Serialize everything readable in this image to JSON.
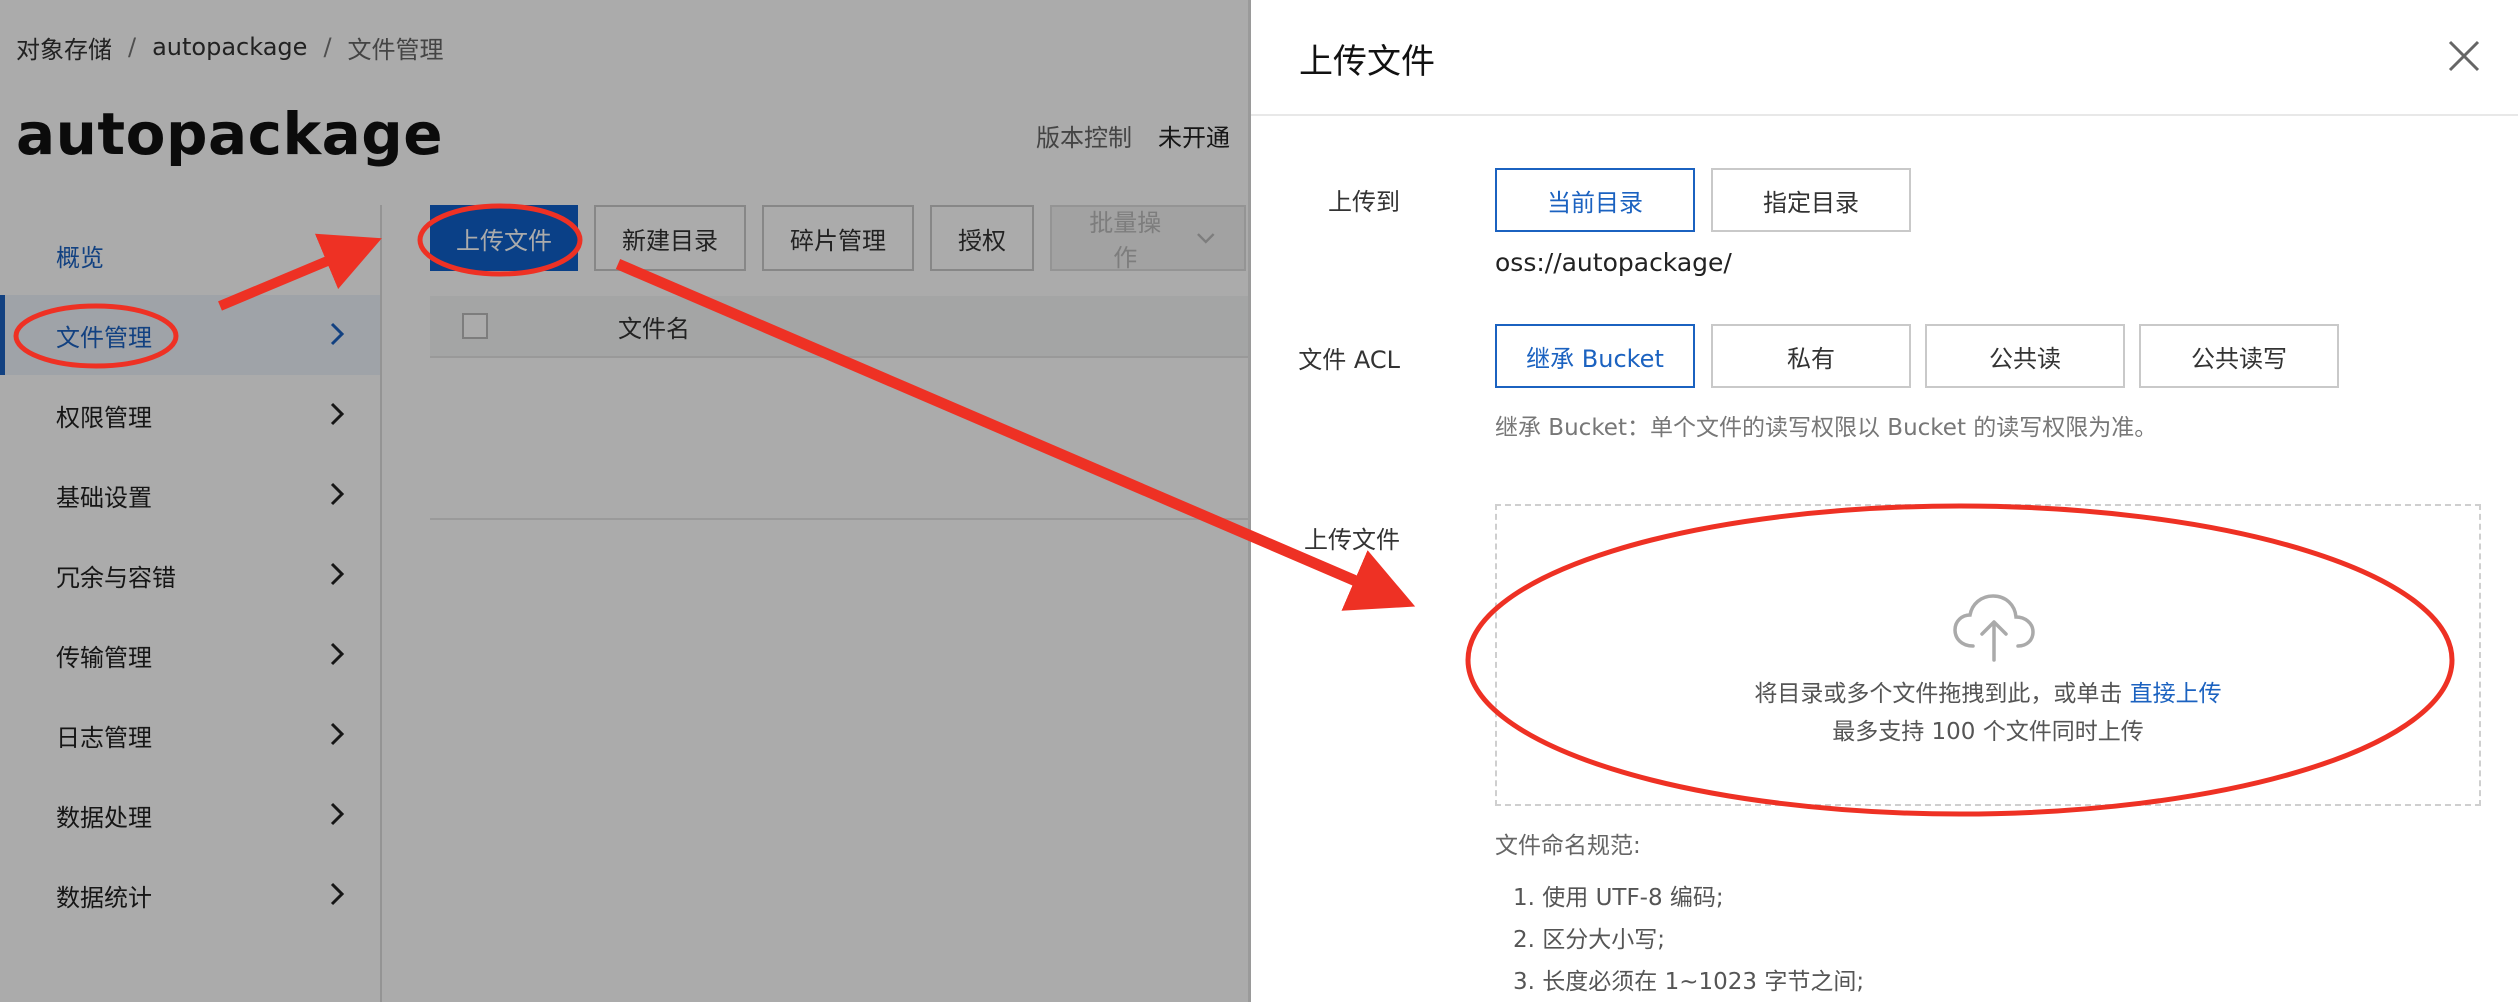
{
  "breadcrumb": {
    "item1": "对象存储",
    "item2": "autopackage",
    "item3": "文件管理",
    "sep": "/"
  },
  "page": {
    "title": "autopackage",
    "version_control": "版本控制",
    "status": "未开通"
  },
  "sidebar": {
    "items": [
      {
        "label": "概览"
      },
      {
        "label": "文件管理"
      },
      {
        "label": "权限管理"
      },
      {
        "label": "基础设置"
      },
      {
        "label": "冗余与容错"
      },
      {
        "label": "传输管理"
      },
      {
        "label": "日志管理"
      },
      {
        "label": "数据处理"
      },
      {
        "label": "数据统计"
      }
    ]
  },
  "toolbar": {
    "upload": "上传文件",
    "new_dir": "新建目录",
    "fragment": "碎片管理",
    "auth": "授权",
    "batch": "批量操作"
  },
  "table": {
    "col_name": "文件名"
  },
  "drawer": {
    "title": "上传文件",
    "upload_to_label": "上传到",
    "current_dir": "当前目录",
    "specify_dir": "指定目录",
    "path": "oss://autopackage/",
    "acl_label": "文件 ACL",
    "acl_inherit": "继承 Bucket",
    "acl_private": "私有",
    "acl_public_read": "公共读",
    "acl_public_rw": "公共读写",
    "acl_hint": "继承 Bucket：单个文件的读写权限以 Bucket 的读写权限为准。",
    "upload_file_label": "上传文件",
    "drop_text": "将目录或多个文件拖拽到此，或单击",
    "drop_link": "直接上传",
    "drop_limit": "最多支持 100 个文件同时上传",
    "rules_title": "文件命名规范:",
    "rules": [
      "1. 使用 UTF-8 编码;",
      "2. 区分大小写;",
      "3. 长度必须在 1~1023 字节之间;"
    ]
  },
  "colors": {
    "primary": "#1060c9",
    "annotation": "#ee3124",
    "mask": "rgba(0,0,0,0.33)"
  },
  "icons": {
    "close": "close-icon",
    "cloud": "cloud-upload-icon",
    "chevron": "chevron-right-icon",
    "dropdown": "chevron-down-icon"
  }
}
